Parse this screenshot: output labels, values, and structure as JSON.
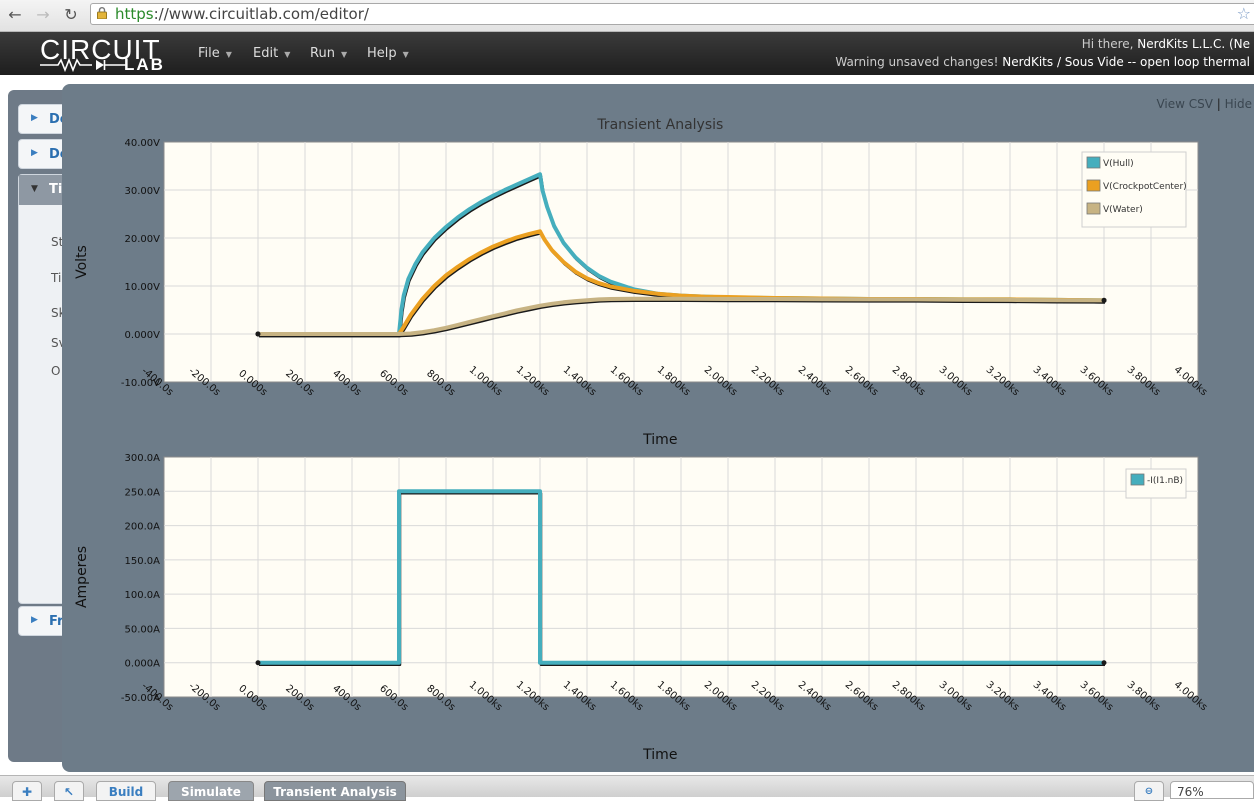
{
  "browser": {
    "url_scheme": "https",
    "url_rest": "://www.circuitlab.com/editor/"
  },
  "app": {
    "logo_top": "CIRCUIT",
    "logo_bottom": "LAB",
    "menus": [
      "File",
      "Edit",
      "Run",
      "Help"
    ],
    "greeting_prefix": "Hi there, ",
    "greeting_user": "NerdKits L.L.C. (Ne",
    "warning": "Warning unsaved changes! ",
    "project_owner": "NerdKits",
    "project_sep": " / ",
    "project_name": "Sous Vide -- open loop thermal"
  },
  "sidebar": {
    "items": [
      {
        "label": "De"
      },
      {
        "label": "De"
      },
      {
        "label": "Ti"
      },
      {
        "label": "Fr"
      }
    ],
    "open_lines": [
      "St",
      "Tin",
      "Sk",
      "Sv",
      "O"
    ]
  },
  "overlay": {
    "view_csv": "View CSV",
    "sep": "|",
    "hide": "Hide"
  },
  "toolbar": {
    "build": "Build",
    "simulate": "Simulate",
    "transient": "Transient Analysis",
    "zoom": "76%"
  },
  "chart_data": [
    {
      "type": "line",
      "title": "Transient Analysis",
      "xlabel": "Time",
      "ylabel": "Volts",
      "xlim": [
        -400,
        4000
      ],
      "ylim": [
        -10,
        40
      ],
      "grid": true,
      "legend_position": "top-right",
      "xticks": [
        "-400.0s",
        "-200.0s",
        "0.000s",
        "200.0s",
        "400.0s",
        "600.0s",
        "800.0s",
        "1.000ks",
        "1.200ks",
        "1.400ks",
        "1.600ks",
        "1.800ks",
        "2.000ks",
        "2.200ks",
        "2.400ks",
        "2.600ks",
        "2.800ks",
        "3.000ks",
        "3.200ks",
        "3.400ks",
        "3.600ks",
        "3.800ks",
        "4.000ks"
      ],
      "yticks": [
        "-10.00V",
        "0.000V",
        "10.00V",
        "20.00V",
        "30.00V",
        "40.00V"
      ],
      "series": [
        {
          "name": "V(Hull)",
          "color": "#45aebd",
          "x": [
            0,
            600,
            610,
            620,
            640,
            670,
            700,
            750,
            800,
            850,
            900,
            950,
            1000,
            1050,
            1100,
            1150,
            1200,
            1210,
            1230,
            1260,
            1300,
            1350,
            1400,
            1450,
            1500,
            1600,
            1700,
            1800,
            1900,
            2000,
            2200,
            2400,
            2600,
            2800,
            3000,
            3200,
            3400,
            3600
          ],
          "y": [
            0,
            0,
            5,
            8,
            11.5,
            14.6,
            17,
            20,
            22.3,
            24.3,
            26,
            27.5,
            28.8,
            30,
            31.1,
            32.2,
            33.3,
            30,
            26.5,
            22.5,
            19,
            16,
            13.8,
            12.1,
            10.9,
            9.3,
            8.4,
            8,
            7.8,
            7.6,
            7.5,
            7.4,
            7.3,
            7.3,
            7.2,
            7.2,
            7.1,
            7.0
          ]
        },
        {
          "name": "V(CrockpotCenter)",
          "color": "#eba021",
          "x": [
            0,
            600,
            620,
            650,
            700,
            750,
            800,
            850,
            900,
            950,
            1000,
            1050,
            1100,
            1150,
            1200,
            1220,
            1250,
            1300,
            1350,
            1400,
            1450,
            1500,
            1600,
            1700,
            1800,
            1900,
            2000,
            2200,
            2400,
            2600,
            2800,
            3000,
            3200,
            3400,
            3600
          ],
          "y": [
            0,
            0,
            1.5,
            4,
            7.3,
            10,
            12.2,
            14,
            15.6,
            17,
            18.2,
            19.2,
            20.1,
            20.8,
            21.4,
            19.6,
            17.5,
            15,
            13,
            11.6,
            10.6,
            9.9,
            9,
            8.4,
            8,
            7.8,
            7.7,
            7.5,
            7.4,
            7.3,
            7.3,
            7.2,
            7.2,
            7.1,
            7.0
          ]
        },
        {
          "name": "V(Water)",
          "color": "#c7b383",
          "x": [
            0,
            600,
            650,
            700,
            750,
            800,
            850,
            900,
            950,
            1000,
            1050,
            1100,
            1150,
            1200,
            1250,
            1300,
            1350,
            1400,
            1450,
            1500,
            1600,
            1700,
            1800,
            2000,
            2200,
            2400,
            2600,
            2800,
            3000,
            3200,
            3400,
            3600
          ],
          "y": [
            0,
            0,
            0.1,
            0.4,
            0.8,
            1.3,
            1.9,
            2.5,
            3.1,
            3.7,
            4.3,
            4.9,
            5.4,
            5.9,
            6.3,
            6.6,
            6.85,
            7.05,
            7.2,
            7.3,
            7.35,
            7.35,
            7.35,
            7.3,
            7.3,
            7.25,
            7.2,
            7.2,
            7.15,
            7.1,
            7.05,
            7.0
          ]
        }
      ]
    },
    {
      "type": "line",
      "title": "",
      "xlabel": "Time",
      "ylabel": "Amperes",
      "xlim": [
        -400,
        4000
      ],
      "ylim": [
        -50,
        300
      ],
      "grid": true,
      "legend_position": "top-right",
      "xticks": [
        "-400.0s",
        "-200.0s",
        "0.000s",
        "200.0s",
        "400.0s",
        "600.0s",
        "800.0s",
        "1.000ks",
        "1.200ks",
        "1.400ks",
        "1.600ks",
        "1.800ks",
        "2.000ks",
        "2.200ks",
        "2.400ks",
        "2.600ks",
        "2.800ks",
        "3.000ks",
        "3.200ks",
        "3.400ks",
        "3.600ks",
        "3.800ks",
        "4.000ks"
      ],
      "yticks": [
        "-50.00A",
        "0.000A",
        "50.00A",
        "100.0A",
        "150.0A",
        "200.0A",
        "250.0A",
        "300.0A"
      ],
      "series": [
        {
          "name": "-I(I1.nB)",
          "color": "#45aebd",
          "x": [
            0,
            600,
            600,
            1200,
            1200,
            3600
          ],
          "y": [
            0,
            0,
            250,
            250,
            0,
            0
          ]
        }
      ]
    }
  ]
}
